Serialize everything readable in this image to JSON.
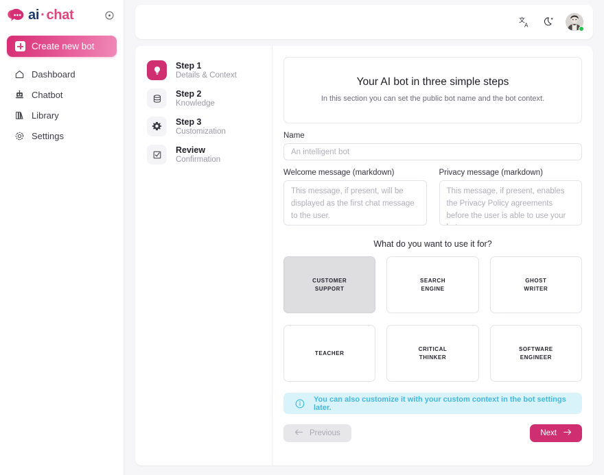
{
  "brand": {
    "name_ai": "ai",
    "separator": "·",
    "name_chat": "chat",
    "logo_icon": "chat-bubble-icon",
    "toggle_icon": "collapse-sidebar-icon"
  },
  "sidebar": {
    "create_button": {
      "label": "Create new bot",
      "icon": "plus-square-icon"
    },
    "items": [
      {
        "label": "Dashboard",
        "icon": "home-icon"
      },
      {
        "label": "Chatbot",
        "icon": "robot-icon"
      },
      {
        "label": "Library",
        "icon": "books-icon"
      },
      {
        "label": "Settings",
        "icon": "gear-icon"
      }
    ]
  },
  "topbar": {
    "translate_icon": "translate-icon",
    "dark_mode_icon": "moon-icon",
    "avatar": "user-avatar",
    "status": "online"
  },
  "steps": [
    {
      "title": "Step 1",
      "subtitle": "Details & Context",
      "icon": "lightbulb-icon",
      "active": true
    },
    {
      "title": "Step 2",
      "subtitle": "Knowledge",
      "icon": "database-icon",
      "active": false
    },
    {
      "title": "Step 3",
      "subtitle": "Customization",
      "icon": "gear-icon",
      "active": false
    },
    {
      "title": "Review",
      "subtitle": "Confirmation",
      "icon": "check-square-icon",
      "active": false
    }
  ],
  "hero": {
    "title": "Your AI bot in three simple steps",
    "subtitle": "In this section you can set the public bot name and the bot context."
  },
  "fields": {
    "name": {
      "label": "Name",
      "value": "",
      "placeholder": "An intelligent bot"
    },
    "welcome": {
      "label": "Welcome message (markdown)",
      "value": "",
      "placeholder": "This message, if present, will be displayed as the first chat message to the user."
    },
    "privacy": {
      "label": "Privacy message (markdown)",
      "value": "",
      "placeholder": "This message, if present, enables the Privacy Policy agreements before the user is able to use your bot."
    }
  },
  "usecases": {
    "title": "What do you want to use it for?",
    "cards": [
      {
        "line1": "CUSTOMER",
        "line2": "SUPPORT",
        "selected": true
      },
      {
        "line1": "SEARCH",
        "line2": "ENGINE",
        "selected": false
      },
      {
        "line1": "GHOST",
        "line2": "WRITER",
        "selected": false
      },
      {
        "line1": "TEACHER",
        "line2": "",
        "selected": false
      },
      {
        "line1": "CRITICAL",
        "line2": "THINKER",
        "selected": false
      },
      {
        "line1": "SOFTWARE",
        "line2": "ENGINEER",
        "selected": false
      }
    ]
  },
  "info": {
    "icon": "info-circle-icon",
    "text": "You can also customize it with your custom context in the bot settings later."
  },
  "actions": {
    "previous": {
      "label": "Previous",
      "icon": "arrow-left-icon",
      "disabled": true
    },
    "next": {
      "label": "Next",
      "icon": "arrow-right-icon",
      "disabled": false
    }
  },
  "colors": {
    "brand_pink": "#e0457b",
    "brand_deep": "#cf2e70",
    "brand_navy": "#1d3a6e",
    "info_bg": "#d9f3fb",
    "info_text": "#44b8dc",
    "status_green": "#24c24f",
    "page_bg": "#f6f6f8"
  }
}
